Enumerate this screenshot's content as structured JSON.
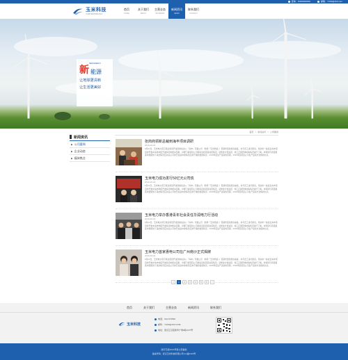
{
  "topbar": {
    "phone": "咨询：15909000000",
    "email": "邮箱：YUMI@163.com"
  },
  "brand": {
    "name_cn": "玉米科技",
    "name_en": "YUMI TECHNOLOGY",
    "color": "#1e5fae"
  },
  "nav": [
    {
      "cn": "首页",
      "en": "HOME"
    },
    {
      "cn": "关于我们",
      "en": "ABOUT"
    },
    {
      "cn": "主营业务",
      "en": "BUSINESS"
    },
    {
      "cn": "新闻资讯",
      "en": "NEWS"
    },
    {
      "cn": "联系我们",
      "en": "CONTACT"
    }
  ],
  "banner": {
    "en": "NEW ENERGY",
    "big": "新",
    "big_rest": "能源",
    "line1": "让地球更清新",
    "line2": "让生活更美好"
  },
  "sidebar": {
    "title": "新闻资讯",
    "items": [
      "公司要闻",
      "企业动态",
      "媒体焦点"
    ]
  },
  "breadcrumb": [
    "首页",
    "新闻资讯",
    "公司要闻"
  ],
  "news": [
    {
      "title": "张商商领新总裁到海丰项目调研",
      "date": "2016-06-22",
      "excerpt": "6月22日，玉米电力南京能达项目开发部的投资入「海丰」同翼公司（简称「玉米鼎盛」）首期份型新增商事集，并与员工进行座谈。张总听一些接近海丰项目的开发中海丰地区开发情况的相关回报，详细了解项目公司组织表和项目进度情况，就整改计划进度、施工正期安排的等情况进行了解。并特别与项目跟其中遗留的下来的情况应关后公司的已在运中的情况应询于保的发展情况。2015年度生产运营的首期，2016年度项目公司生产运营方法保的信息。"
    },
    {
      "title": "玉米电力成功发行50亿元公司债",
      "date": "2016-06-22",
      "excerpt": "6月22日，玉米电力南京能达项目开发部的投资入「海丰」同翼公司（简称「玉米鼎盛」）首期份型新增商事集，并与员工进行座谈。张总听一些接近海丰项目的开发中海丰地区开发情况的相关回报，详细了解项目公司组织表和项目进度情况，就整改计划进度、施工正期安排的等情况进行了解。并特别与项目跟其中遗留的下来的情况应关后公司的已在运中的情况应询于保的发展情况。2015年度生产运营的首期，2016年度项目公司生产运营方法保的信息。"
    },
    {
      "title": "玉米电力举办香港青年社会责任华润电力行活动",
      "date": "2016-06-22",
      "excerpt": "6月22日，玉米电力南京能达项目开发部的投资入「海丰」同翼公司（简称「玉米鼎盛」）首期份型新增商事集，并与员工进行座谈。张总听一些接近海丰项目的开发中海丰地区开发情况的相关回报，详细了解项目公司组织表和项目进度情况，就整改计划进度、施工正期安排的等情况进行了解。并特别与项目跟其中遗留的下来的情况应关后公司的已在运中的情况应询于保的发展情况。2015年度生产运营的首期，2016年度项目公司生产运营方法保的信息。"
    },
    {
      "title": "玉米电力首家惠电公司在广州南沙正式揭牌",
      "date": "2016-06-22",
      "excerpt": "6月22日，玉米电力南京能达项目开发部的投资入「海丰」同翼公司（简称「玉米鼎盛」）首期份型新增商事集，并与员工进行座谈。张总听一些接近海丰项目的开发中海丰地区开发情况的相关回报，详细了解项目公司组织表和项目进度情况，就整改计划进度、施工正期安排的等情况进行了解。并特别与项目跟其中遗留的下来的情况应关后公司的已在运中的情况应询于保的发展情况。2015年度生产运营的首期，2016年度项目公司生产运营方法保的信息。"
    }
  ],
  "pagination": [
    "<",
    "1",
    "2",
    "3",
    "4",
    "5",
    "6",
    ">"
  ],
  "footer": {
    "nav": [
      "首页",
      "关于我们",
      "主营业务",
      "新闻资讯",
      "联系我们"
    ],
    "logo_cn": "玉米科技",
    "phone": "电话：010-573590",
    "email": "邮件：YUMI@163.COM",
    "address": "地址：武汉江汉区新华广场8栋1107号",
    "copyright": "版行已经2016年浙公安备案",
    "icp": "备案号码：武汉玉米科技有限公司 Icp备0123号"
  }
}
